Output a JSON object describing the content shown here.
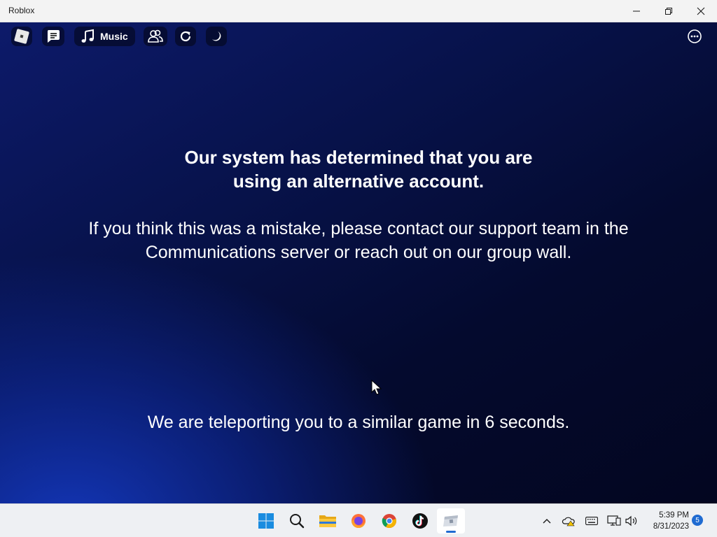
{
  "window": {
    "title": "Roblox",
    "controls": [
      "minimize",
      "restore",
      "close"
    ]
  },
  "topbar": {
    "music_label": "Music",
    "icons": [
      "roblox-menu-icon",
      "chat-icon",
      "music-note-icon",
      "friends-icon",
      "refresh-icon",
      "moon-icon",
      "more-options-icon"
    ]
  },
  "message": {
    "heading_line1": "Our system has determined that you are",
    "heading_line2": "using an alternative account.",
    "body_line1": "If you think this was a mistake, please contact our support team in the",
    "body_line2": "Communications server or reach out on our group wall.",
    "teleport": "We are teleporting you to a similar game in 6 seconds."
  },
  "taskbar": {
    "apps": [
      "start",
      "search",
      "file-explorer",
      "firefox",
      "chrome",
      "tiktok",
      "roblox"
    ],
    "active_app": "roblox",
    "time": "5:39 PM",
    "date": "8/31/2023",
    "notification_count": "5"
  },
  "colors": {
    "game_bg_dark": "#030620",
    "game_bg_blue": "#1438be",
    "taskbar_bg": "#eef0f3",
    "accent": "#1f6bd1"
  }
}
